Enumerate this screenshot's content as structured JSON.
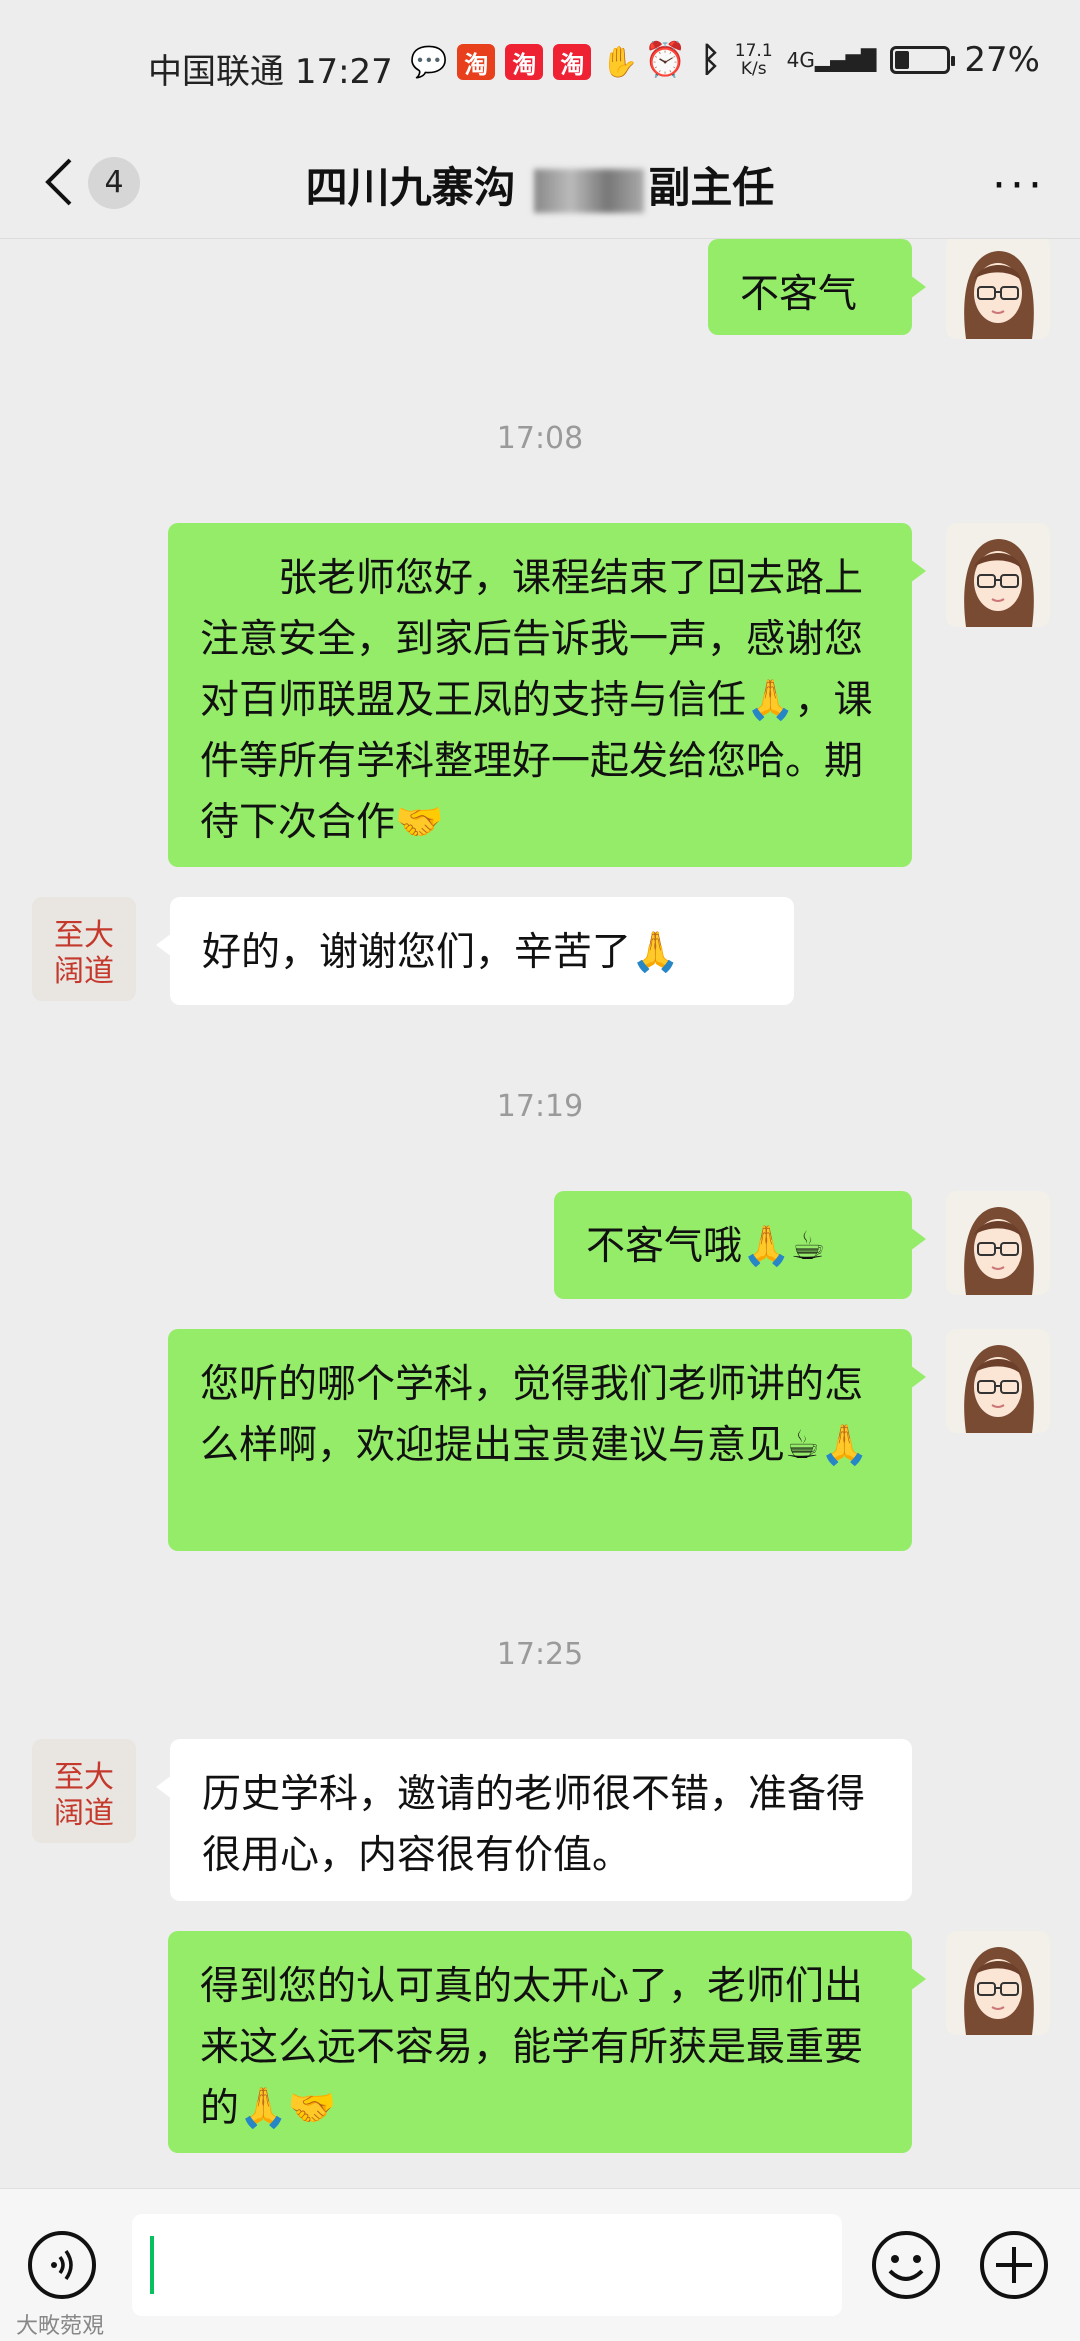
{
  "status": {
    "carrier": "中国联通",
    "time": "17:27",
    "app_icons": [
      "淘",
      "淘",
      "淘"
    ],
    "net_speed_value": "17.1",
    "net_speed_unit": "K/s",
    "signal": "4G",
    "battery_percent": "27%",
    "battery_level": 0.27
  },
  "header": {
    "unread_count": "4",
    "title_prefix": "四川九寨沟",
    "title_suffix": "副主任",
    "more_label": "···"
  },
  "messages": {
    "m1": "不客气",
    "t1": "17:08",
    "m2": "　　张老师您好，课程结束了回去路上注意安全，到家后告诉我一声，感谢您对百师联盟及王凤的支持与信任🙏，课件等所有学科整理好一起发给您哈。期待下次合作🤝",
    "m3": "好的，谢谢您们，辛苦了🙏",
    "t2": "17:19",
    "m4": "不客气哦🙏☕",
    "m5": "您听的哪个学科，觉得我们老师讲的怎么样啊，欢迎提出宝贵建议与意见☕🙏",
    "t3": "17:25",
    "m6": "历史学科，邀请的老师很不错，准备得很用心，内容很有价值。",
    "m7": "得到您的认可真的太开心了，老师们出来这么远不容易，能学有所获是最重要的🙏🤝"
  },
  "other_avatar_text": "至大 阔道",
  "watermark": "大畋菀覌",
  "colors": {
    "sent_bubble": "#95ec69",
    "received_bubble": "#ffffff",
    "background": "#ededed",
    "cursor": "#07c160"
  }
}
